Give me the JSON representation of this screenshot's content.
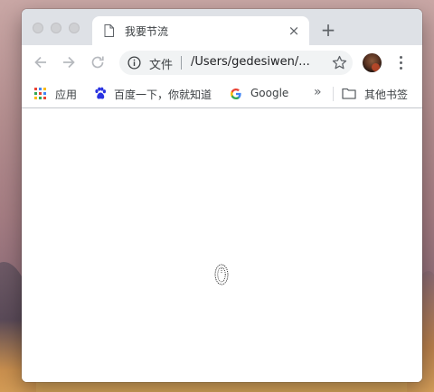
{
  "browser": {
    "tab": {
      "title": "我要节流",
      "close_symbol": "×"
    },
    "new_tab_symbol": "+",
    "omnibox": {
      "security_label": "文件",
      "url": "/Users/gedesiwen/..."
    },
    "bookmarks": [
      {
        "label": "应用",
        "icon": "apps-grid-icon"
      },
      {
        "label": "百度一下，你就知道",
        "icon": "baidu-paw-icon"
      },
      {
        "label": "Google",
        "icon": "google-g-icon"
      }
    ],
    "overflow_symbol": "»",
    "other_bookmarks": {
      "label": "其他书签",
      "icon": "folder-icon"
    }
  },
  "colors": {
    "titlebar": "#dee1e6",
    "omnibox": "#f1f3f4",
    "icon_gray": "#5f6368",
    "google_blue": "#4285f4",
    "google_red": "#ea4335",
    "google_yellow": "#fbbc05",
    "google_green": "#34a853",
    "baidu_blue": "#2932e1"
  },
  "page": {
    "cursor_icon": "mouse-cursor-outline-icon"
  }
}
